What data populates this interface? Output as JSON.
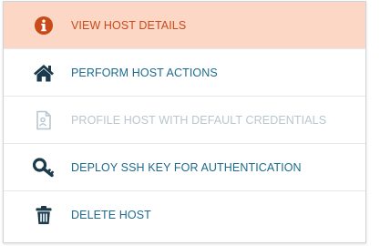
{
  "menu": {
    "items": [
      {
        "label": "VIEW HOST DETAILS",
        "icon": "info-circle-icon",
        "state": "active"
      },
      {
        "label": "PERFORM HOST ACTIONS",
        "icon": "home-icon",
        "state": "normal"
      },
      {
        "label": "PROFILE HOST WITH DEFAULT CREDENTIALS",
        "icon": "profile-document-icon",
        "state": "disabled"
      },
      {
        "label": "DEPLOY SSH KEY FOR AUTHENTICATION",
        "icon": "key-icon",
        "state": "normal"
      },
      {
        "label": "DELETE HOST",
        "icon": "trash-icon",
        "state": "normal"
      }
    ]
  },
  "colors": {
    "active_background": "#fcd7c5",
    "active_text": "#c84a1a",
    "normal_text": "#1d6a8e",
    "disabled_text": "#b8c6cf",
    "icon_dark": "#1b3a4b"
  }
}
